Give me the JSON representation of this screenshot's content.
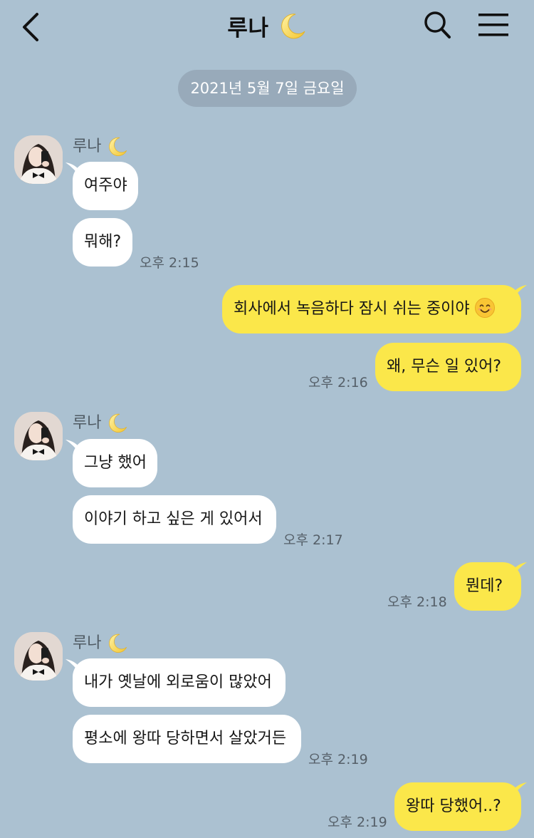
{
  "header": {
    "title": "루나"
  },
  "date_divider": "2021년 5월 7일 금요일",
  "contact": {
    "name": "루나"
  },
  "messages": [
    {
      "text": "여주야"
    },
    {
      "text": "뭐해?",
      "time": "오후 2:15"
    },
    {
      "text": "회사에서 녹음하다 잠시 쉬는 중이야"
    },
    {
      "text": "왜, 무슨 일 있어?",
      "time": "오후 2:16"
    },
    {
      "text": "그냥 했어"
    },
    {
      "text": "이야기 하고 싶은 게 있어서",
      "time": "오후 2:17"
    },
    {
      "text": "뭔데?",
      "time": "오후 2:18"
    },
    {
      "text": "내가 옛날에 외로움이 많았어"
    },
    {
      "text": "평소에 왕따 당하면서 살았거든",
      "time": "오후 2:19"
    },
    {
      "text": "왕따 당했어..?",
      "time": "오후 2:19"
    }
  ],
  "colors": {
    "background": "#abc1d1",
    "incoming_bubble": "#ffffff",
    "outgoing_bubble": "#fbe74a",
    "date_pill": "#98aaba"
  },
  "icons": [
    "back-arrow-icon",
    "crescent-moon-icon",
    "search-icon",
    "menu-icon",
    "smiling-face-emoji"
  ]
}
